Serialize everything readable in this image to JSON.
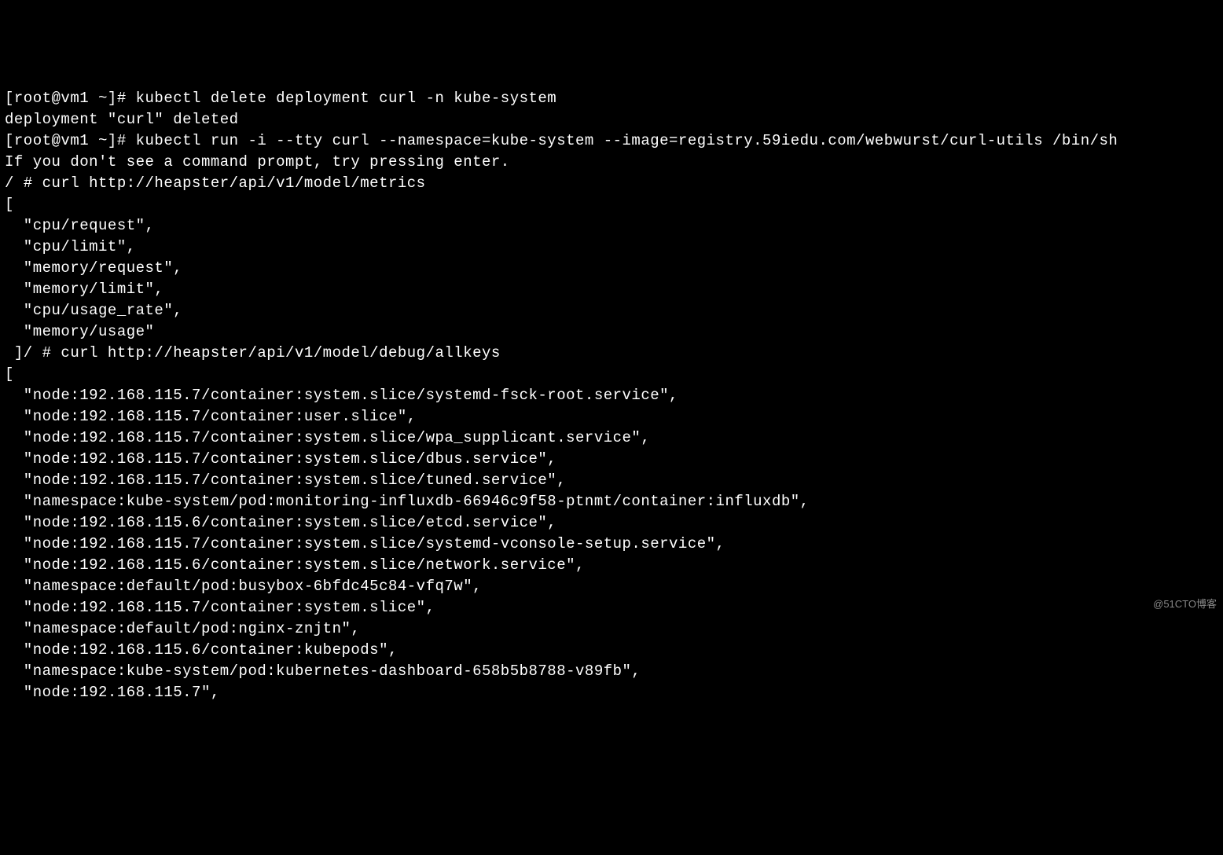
{
  "terminal": {
    "lines": [
      "[root@vm1 ~]# kubectl delete deployment curl -n kube-system",
      "deployment \"curl\" deleted",
      "[root@vm1 ~]# kubectl run -i --tty curl --namespace=kube-system --image=registry.59iedu.com/webwurst/curl-utils /bin/sh",
      "If you don't see a command prompt, try pressing enter.",
      "/ # curl http://heapster/api/v1/model/metrics",
      "[",
      "  \"cpu/request\",",
      "  \"cpu/limit\",",
      "  \"memory/request\",",
      "  \"memory/limit\",",
      "  \"cpu/usage_rate\",",
      "  \"memory/usage\"",
      " ]/ # curl http://heapster/api/v1/model/debug/allkeys",
      "[",
      "  \"node:192.168.115.7/container:system.slice/systemd-fsck-root.service\",",
      "  \"node:192.168.115.7/container:user.slice\",",
      "  \"node:192.168.115.7/container:system.slice/wpa_supplicant.service\",",
      "  \"node:192.168.115.7/container:system.slice/dbus.service\",",
      "  \"node:192.168.115.7/container:system.slice/tuned.service\",",
      "  \"namespace:kube-system/pod:monitoring-influxdb-66946c9f58-ptnmt/container:influxdb\",",
      "  \"node:192.168.115.6/container:system.slice/etcd.service\",",
      "  \"node:192.168.115.7/container:system.slice/systemd-vconsole-setup.service\",",
      "  \"node:192.168.115.6/container:system.slice/network.service\",",
      "  \"namespace:default/pod:busybox-6bfdc45c84-vfq7w\",",
      "  \"node:192.168.115.7/container:system.slice\",",
      "  \"namespace:default/pod:nginx-znjtn\",",
      "  \"node:192.168.115.6/container:kubepods\",",
      "  \"namespace:kube-system/pod:kubernetes-dashboard-658b5b8788-v89fb\",",
      "  \"node:192.168.115.7\","
    ]
  },
  "watermark": "@51CTO博客"
}
